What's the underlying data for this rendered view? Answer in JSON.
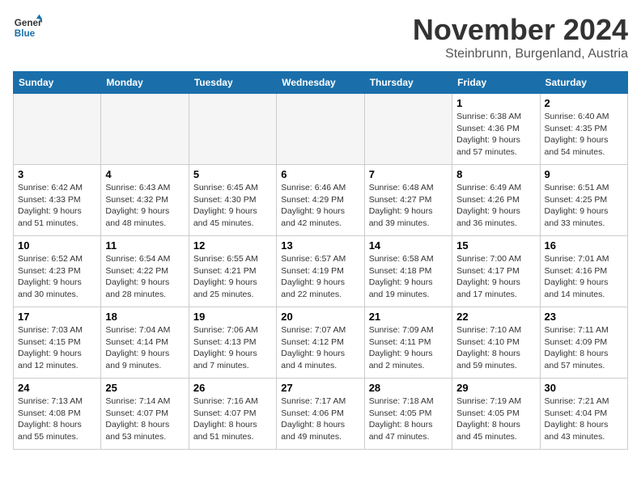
{
  "logo": {
    "line1": "General",
    "line2": "Blue"
  },
  "title": "November 2024",
  "subtitle": "Steinbrunn, Burgenland, Austria",
  "days_of_week": [
    "Sunday",
    "Monday",
    "Tuesday",
    "Wednesday",
    "Thursday",
    "Friday",
    "Saturday"
  ],
  "weeks": [
    [
      {
        "day": "",
        "detail": ""
      },
      {
        "day": "",
        "detail": ""
      },
      {
        "day": "",
        "detail": ""
      },
      {
        "day": "",
        "detail": ""
      },
      {
        "day": "",
        "detail": ""
      },
      {
        "day": "1",
        "detail": "Sunrise: 6:38 AM\nSunset: 4:36 PM\nDaylight: 9 hours and 57 minutes."
      },
      {
        "day": "2",
        "detail": "Sunrise: 6:40 AM\nSunset: 4:35 PM\nDaylight: 9 hours and 54 minutes."
      }
    ],
    [
      {
        "day": "3",
        "detail": "Sunrise: 6:42 AM\nSunset: 4:33 PM\nDaylight: 9 hours and 51 minutes."
      },
      {
        "day": "4",
        "detail": "Sunrise: 6:43 AM\nSunset: 4:32 PM\nDaylight: 9 hours and 48 minutes."
      },
      {
        "day": "5",
        "detail": "Sunrise: 6:45 AM\nSunset: 4:30 PM\nDaylight: 9 hours and 45 minutes."
      },
      {
        "day": "6",
        "detail": "Sunrise: 6:46 AM\nSunset: 4:29 PM\nDaylight: 9 hours and 42 minutes."
      },
      {
        "day": "7",
        "detail": "Sunrise: 6:48 AM\nSunset: 4:27 PM\nDaylight: 9 hours and 39 minutes."
      },
      {
        "day": "8",
        "detail": "Sunrise: 6:49 AM\nSunset: 4:26 PM\nDaylight: 9 hours and 36 minutes."
      },
      {
        "day": "9",
        "detail": "Sunrise: 6:51 AM\nSunset: 4:25 PM\nDaylight: 9 hours and 33 minutes."
      }
    ],
    [
      {
        "day": "10",
        "detail": "Sunrise: 6:52 AM\nSunset: 4:23 PM\nDaylight: 9 hours and 30 minutes."
      },
      {
        "day": "11",
        "detail": "Sunrise: 6:54 AM\nSunset: 4:22 PM\nDaylight: 9 hours and 28 minutes."
      },
      {
        "day": "12",
        "detail": "Sunrise: 6:55 AM\nSunset: 4:21 PM\nDaylight: 9 hours and 25 minutes."
      },
      {
        "day": "13",
        "detail": "Sunrise: 6:57 AM\nSunset: 4:19 PM\nDaylight: 9 hours and 22 minutes."
      },
      {
        "day": "14",
        "detail": "Sunrise: 6:58 AM\nSunset: 4:18 PM\nDaylight: 9 hours and 19 minutes."
      },
      {
        "day": "15",
        "detail": "Sunrise: 7:00 AM\nSunset: 4:17 PM\nDaylight: 9 hours and 17 minutes."
      },
      {
        "day": "16",
        "detail": "Sunrise: 7:01 AM\nSunset: 4:16 PM\nDaylight: 9 hours and 14 minutes."
      }
    ],
    [
      {
        "day": "17",
        "detail": "Sunrise: 7:03 AM\nSunset: 4:15 PM\nDaylight: 9 hours and 12 minutes."
      },
      {
        "day": "18",
        "detail": "Sunrise: 7:04 AM\nSunset: 4:14 PM\nDaylight: 9 hours and 9 minutes."
      },
      {
        "day": "19",
        "detail": "Sunrise: 7:06 AM\nSunset: 4:13 PM\nDaylight: 9 hours and 7 minutes."
      },
      {
        "day": "20",
        "detail": "Sunrise: 7:07 AM\nSunset: 4:12 PM\nDaylight: 9 hours and 4 minutes."
      },
      {
        "day": "21",
        "detail": "Sunrise: 7:09 AM\nSunset: 4:11 PM\nDaylight: 9 hours and 2 minutes."
      },
      {
        "day": "22",
        "detail": "Sunrise: 7:10 AM\nSunset: 4:10 PM\nDaylight: 8 hours and 59 minutes."
      },
      {
        "day": "23",
        "detail": "Sunrise: 7:11 AM\nSunset: 4:09 PM\nDaylight: 8 hours and 57 minutes."
      }
    ],
    [
      {
        "day": "24",
        "detail": "Sunrise: 7:13 AM\nSunset: 4:08 PM\nDaylight: 8 hours and 55 minutes."
      },
      {
        "day": "25",
        "detail": "Sunrise: 7:14 AM\nSunset: 4:07 PM\nDaylight: 8 hours and 53 minutes."
      },
      {
        "day": "26",
        "detail": "Sunrise: 7:16 AM\nSunset: 4:07 PM\nDaylight: 8 hours and 51 minutes."
      },
      {
        "day": "27",
        "detail": "Sunrise: 7:17 AM\nSunset: 4:06 PM\nDaylight: 8 hours and 49 minutes."
      },
      {
        "day": "28",
        "detail": "Sunrise: 7:18 AM\nSunset: 4:05 PM\nDaylight: 8 hours and 47 minutes."
      },
      {
        "day": "29",
        "detail": "Sunrise: 7:19 AM\nSunset: 4:05 PM\nDaylight: 8 hours and 45 minutes."
      },
      {
        "day": "30",
        "detail": "Sunrise: 7:21 AM\nSunset: 4:04 PM\nDaylight: 8 hours and 43 minutes."
      }
    ]
  ]
}
